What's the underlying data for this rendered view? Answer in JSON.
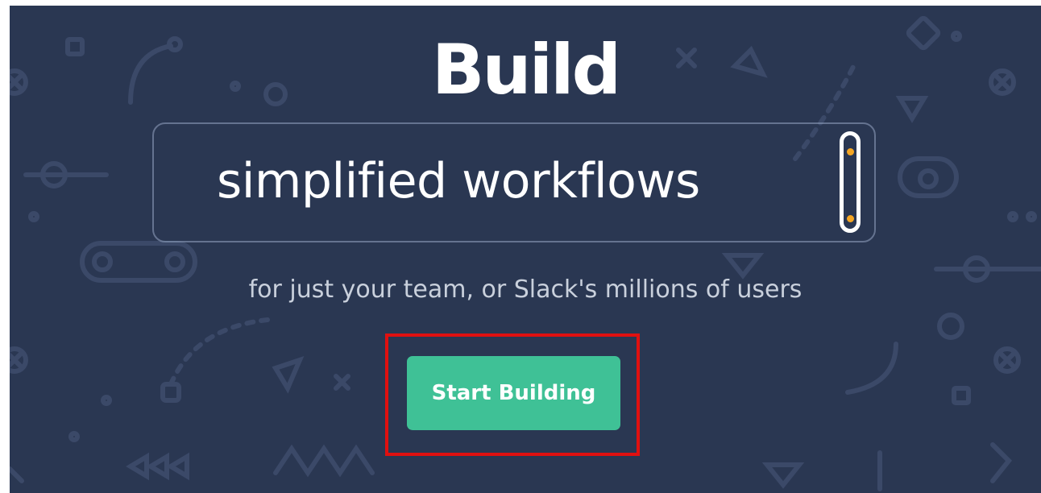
{
  "hero": {
    "title": "Build",
    "rotating_text": "simplified workflows",
    "subtitle": "for just your team, or Slack's millions of users",
    "cta_label": "Start Building"
  },
  "colors": {
    "background": "#2a3752",
    "cta_background": "#3fc196",
    "scroll_dot": "#f5a623",
    "highlight_box": "#e01010"
  },
  "icons": [
    "scroll-handle-icon",
    "gear-icon",
    "circle-x-icon",
    "triangle-icon",
    "diamond-icon",
    "dot-icon"
  ]
}
